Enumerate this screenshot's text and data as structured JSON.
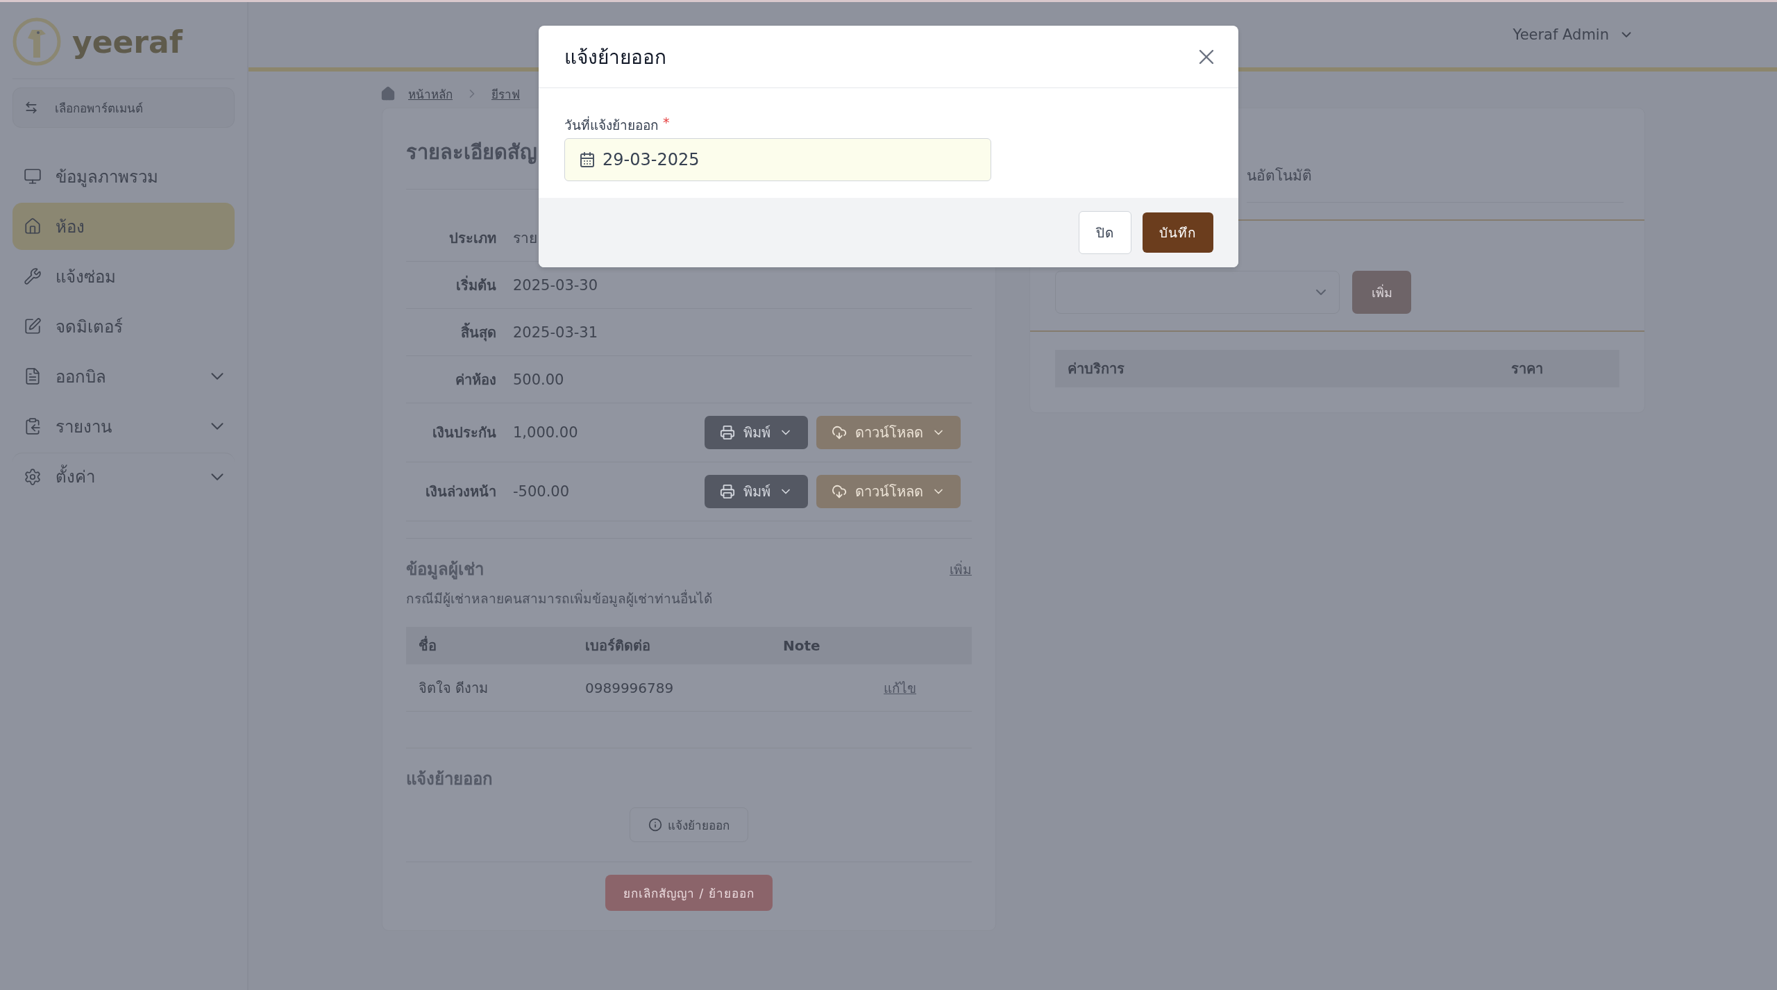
{
  "logo": {
    "text": "yeeraf"
  },
  "sidebar": {
    "switcher": "เลือกอพาร์ตเมนต์",
    "items": [
      {
        "label": "ข้อมูลภาพรวม",
        "selected": false,
        "expandable": false
      },
      {
        "label": "ห้อง",
        "selected": true,
        "expandable": false
      },
      {
        "label": "แจ้งซ่อม",
        "selected": false,
        "expandable": false
      },
      {
        "label": "จดมิเตอร์",
        "selected": false,
        "expandable": false
      },
      {
        "label": "ออกบิล",
        "selected": false,
        "expandable": true
      },
      {
        "label": "รายงาน",
        "selected": false,
        "expandable": true
      },
      {
        "label": "ตั้งค่า",
        "selected": false,
        "expandable": true
      }
    ]
  },
  "header": {
    "user": "Yeeraf Admin"
  },
  "breadcrumb": [
    "หน้าหลัก",
    "ยีราฟ"
  ],
  "contract": {
    "title": "รายละเอียดสัญ",
    "rows": [
      {
        "label": "ประเภท",
        "value": "ราย",
        "kind": "plain"
      },
      {
        "label": "เริ่มต้น",
        "value": "2025-03-30",
        "kind": "plain"
      },
      {
        "label": "สิ้นสุด",
        "value": "2025-03-31",
        "kind": "plain"
      },
      {
        "label": "ค่าห้อง",
        "value": "500.00",
        "kind": "plain"
      },
      {
        "label": "เงินประกัน",
        "value": "1,000.00",
        "kind": "actions",
        "print": "พิมพ์",
        "download": "ดาวน์โหลด"
      },
      {
        "label": "เงินล่วงหน้า",
        "value": "-500.00",
        "kind": "actions",
        "print": "พิมพ์",
        "download": "ดาวน์โหลด"
      }
    ]
  },
  "tenants": {
    "title": "ข้อมูลผู้เช่า",
    "subtitle": "กรณีมีผู้เช่าหลายคนสามารถเพิ่มข้อมูลผู้เช่าท่านอื่นได้",
    "add": "เพิ่ม",
    "columns": [
      "ชื่อ",
      "เบอร์ติดต่อ",
      "Note"
    ],
    "rows": [
      {
        "name": "จิตใจ ดีงาม",
        "phone": "0989996789",
        "action": "แก้ไข"
      }
    ]
  },
  "move_out": {
    "title": "แจ้งย้ายออก",
    "button": "แจ้งย้ายออก"
  },
  "cancel_button": "ยกเลิกสัญญา / ย้ายออก",
  "services": {
    "hint": "นอัตโนมัติ",
    "add_button": "เพิ่ม",
    "columns": [
      "ค่าบริการ",
      "ราคา"
    ]
  },
  "modal": {
    "title": "แจ้งย้ายออก",
    "field": {
      "label": "วันที่แจ้งย้ายออก",
      "required_mark": "*",
      "value": "29-03-2025"
    },
    "buttons": [
      {
        "label": "ปิด",
        "kind": "secondary"
      },
      {
        "label": "บันทึก",
        "kind": "primary"
      }
    ]
  }
}
